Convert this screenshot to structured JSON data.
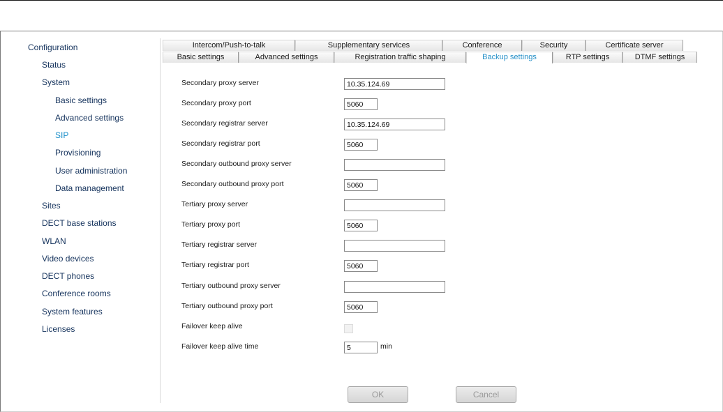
{
  "sidebar": {
    "items": [
      {
        "label": "Configuration"
      },
      {
        "label": "Status"
      },
      {
        "label": "System"
      },
      {
        "label": "Basic settings"
      },
      {
        "label": "Advanced settings"
      },
      {
        "label": "SIP"
      },
      {
        "label": "Provisioning"
      },
      {
        "label": "User administration"
      },
      {
        "label": "Data management"
      },
      {
        "label": "Sites"
      },
      {
        "label": "DECT base stations"
      },
      {
        "label": "WLAN"
      },
      {
        "label": "Video devices"
      },
      {
        "label": "DECT phones"
      },
      {
        "label": "Conference rooms"
      },
      {
        "label": "System features"
      },
      {
        "label": "Licenses"
      }
    ],
    "active": "SIP"
  },
  "tabs": {
    "row1": [
      "Intercom/Push-to-talk",
      "Supplementary services",
      "Conference",
      "Security",
      "Certificate server"
    ],
    "row2": [
      "Basic settings",
      "Advanced settings",
      "Registration traffic shaping",
      "Backup settings",
      "RTP settings",
      "DTMF settings"
    ],
    "active": "Backup settings"
  },
  "form": {
    "secondary_proxy_server": {
      "label": "Secondary proxy server",
      "value": "10.35.124.69"
    },
    "secondary_proxy_port": {
      "label": "Secondary proxy port",
      "value": "5060"
    },
    "secondary_registrar_server": {
      "label": "Secondary registrar server",
      "value": "10.35.124.69"
    },
    "secondary_registrar_port": {
      "label": "Secondary registrar port",
      "value": "5060"
    },
    "secondary_outbound_proxy_server": {
      "label": "Secondary outbound proxy server",
      "value": ""
    },
    "secondary_outbound_proxy_port": {
      "label": "Secondary outbound proxy port",
      "value": "5060"
    },
    "tertiary_proxy_server": {
      "label": "Tertiary proxy server",
      "value": ""
    },
    "tertiary_proxy_port": {
      "label": "Tertiary proxy port",
      "value": "5060"
    },
    "tertiary_registrar_server": {
      "label": "Tertiary registrar server",
      "value": ""
    },
    "tertiary_registrar_port": {
      "label": "Tertiary registrar port",
      "value": "5060"
    },
    "tertiary_outbound_proxy_server": {
      "label": "Tertiary outbound proxy server",
      "value": ""
    },
    "tertiary_outbound_proxy_port": {
      "label": "Tertiary outbound proxy port",
      "value": "5060"
    },
    "failover_keep_alive": {
      "label": "Failover keep alive",
      "checked": false
    },
    "failover_keep_alive_time": {
      "label": "Failover keep alive time",
      "value": "5",
      "unit": "min"
    }
  },
  "buttons": {
    "ok": "OK",
    "cancel": "Cancel"
  }
}
